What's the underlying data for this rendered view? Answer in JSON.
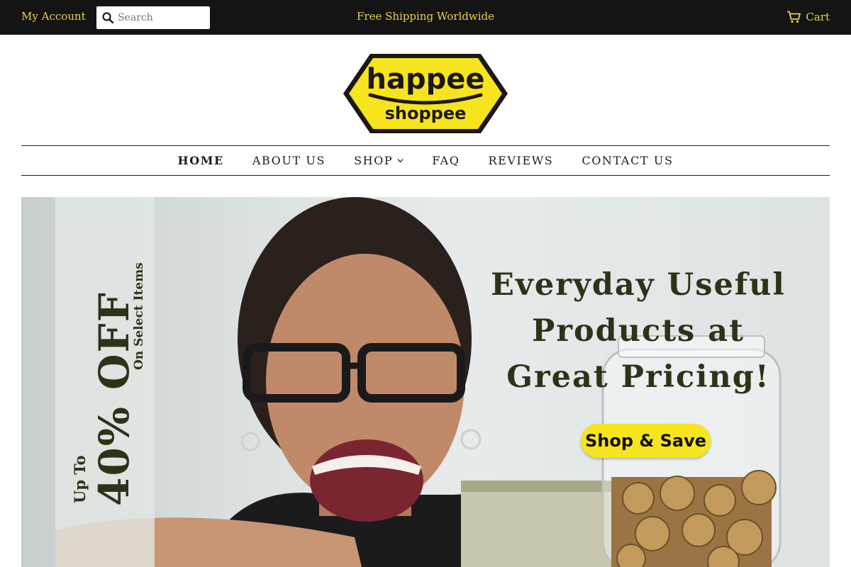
{
  "topbar": {
    "account_label": "My Account",
    "search_placeholder": "Search",
    "announcement": "Free Shipping Worldwide",
    "cart_label": "Cart",
    "accent_color": "#e8d24c",
    "background_color": "#141414",
    "icons": [
      "search-icon",
      "cart-icon"
    ]
  },
  "logo": {
    "line1": "happee",
    "line2": "shoppee",
    "fill_color": "#f6e41e"
  },
  "nav": {
    "items": [
      {
        "label": "HOME",
        "active": true
      },
      {
        "label": "ABOUT US"
      },
      {
        "label": "SHOP",
        "has_dropdown": true
      },
      {
        "label": "FAQ"
      },
      {
        "label": "REVIEWS"
      },
      {
        "label": "CONTACT US"
      }
    ]
  },
  "hero": {
    "promo_upto": "Up To",
    "promo_percent": "40% OFF",
    "promo_select": "On Select Items",
    "headline": [
      "Everyday Useful",
      "Products at",
      "Great Pricing!"
    ],
    "cta_label": "Shop & Save",
    "cta_color": "#f6e41e",
    "text_color": "#2c3318"
  }
}
